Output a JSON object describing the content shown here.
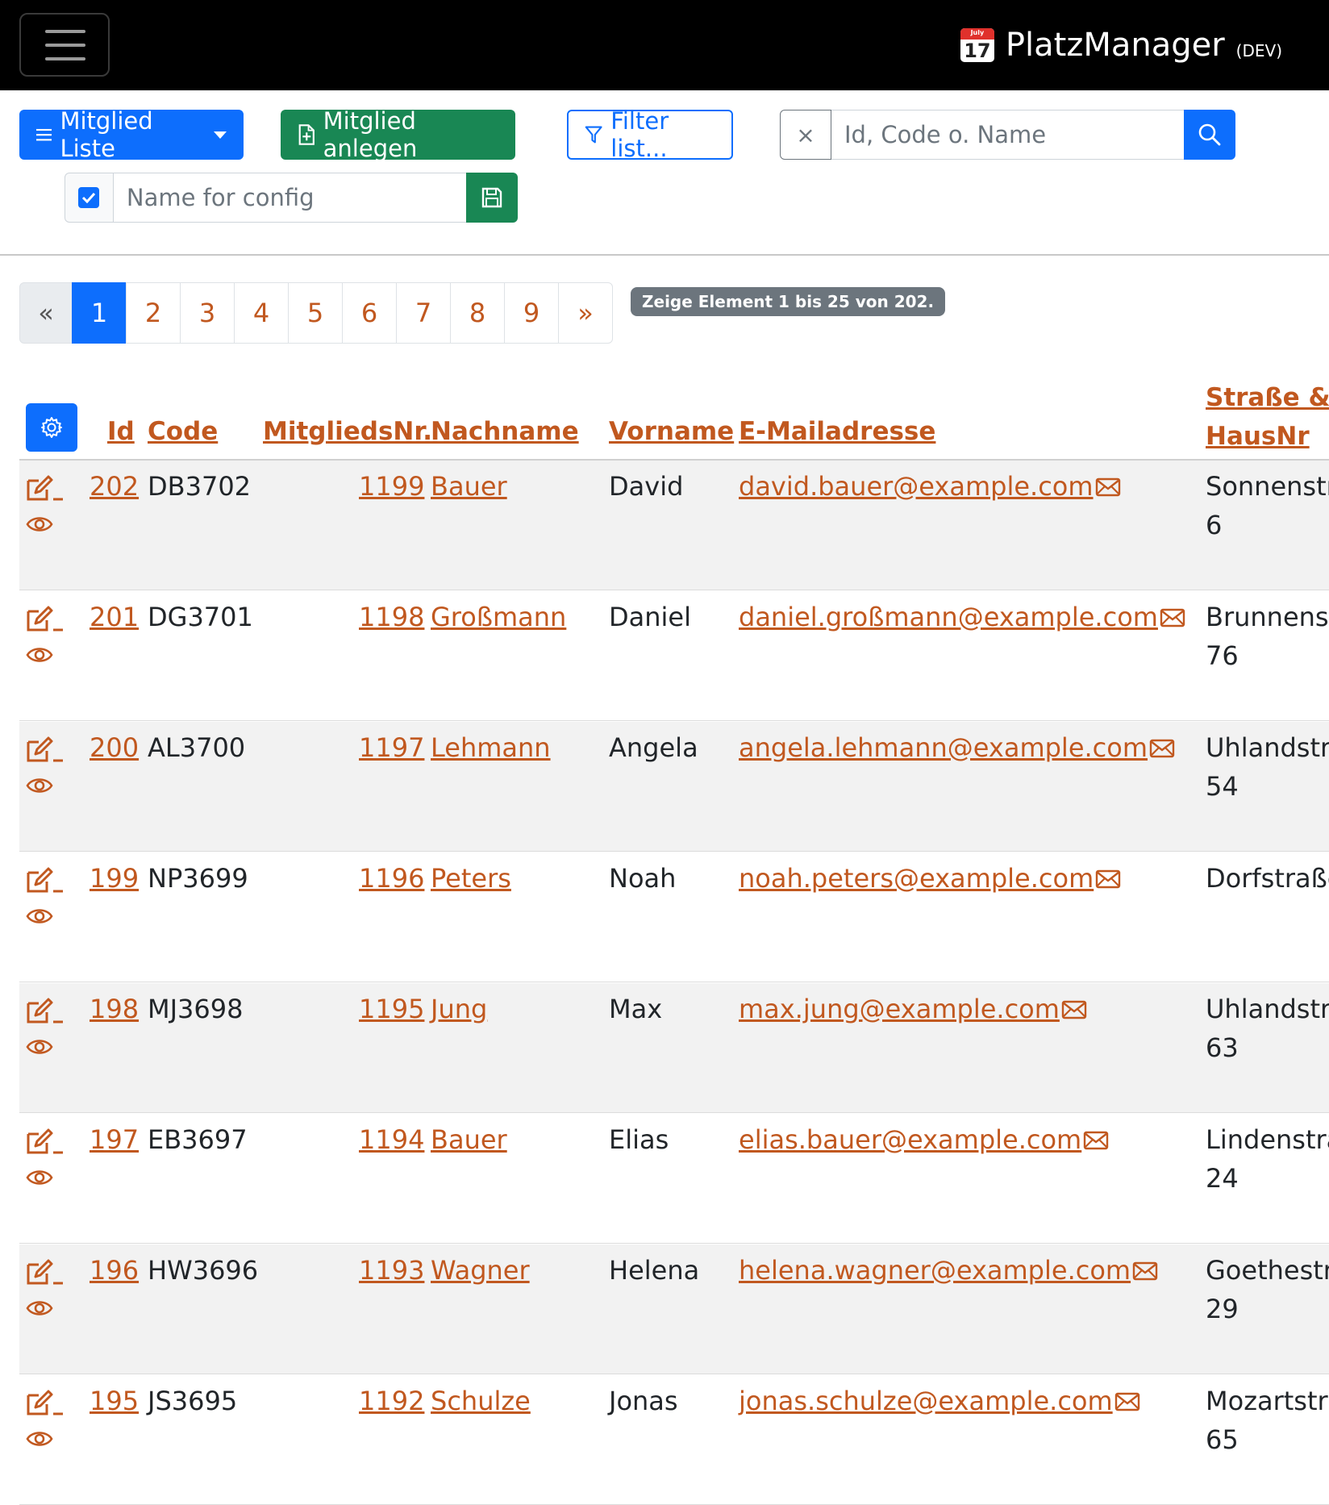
{
  "navbar": {
    "brand": "PlatzManager",
    "env": "(DEV)",
    "calendar_month": "July",
    "calendar_day": "17"
  },
  "toolbar": {
    "list_button": "Mitglied Liste",
    "create_button": "Mitglied anlegen",
    "filter_button": "Filter list...",
    "clear_symbol": "×",
    "search_placeholder": "Id, Code o. Name",
    "search_value": "",
    "config_placeholder": "Name for config",
    "config_value": ""
  },
  "pagination": {
    "prev": "«",
    "pages": [
      "1",
      "2",
      "3",
      "4",
      "5",
      "6",
      "7",
      "8",
      "9"
    ],
    "next": "»",
    "active": "1",
    "summary": "Zeige Element 1 bis 25 von 202."
  },
  "table": {
    "headers": {
      "id": "Id",
      "code": "Code",
      "mitgliedsnr": "MitgliedsNr.",
      "nachname": "Nachname",
      "vorname": "Vorname",
      "email": "E-Mailadresse",
      "strasse_line1": "Straße &",
      "strasse_line2": "HausNr"
    },
    "rows": [
      {
        "id": "202",
        "code": "DB3702",
        "nr": "1199",
        "nachname": "Bauer",
        "vorname": "David",
        "email": "david.bauer@example.com",
        "strasse": "Sonnenstr",
        "hausnr": "6"
      },
      {
        "id": "201",
        "code": "DG3701",
        "nr": "1198",
        "nachname": "Großmann",
        "vorname": "Daniel",
        "email": "daniel.großmann@example.com",
        "strasse": "Brunnenst",
        "hausnr": "76"
      },
      {
        "id": "200",
        "code": "AL3700",
        "nr": "1197",
        "nachname": "Lehmann",
        "vorname": "Angela",
        "email": "angela.lehmann@example.com",
        "strasse": "Uhlandstra",
        "hausnr": "54"
      },
      {
        "id": "199",
        "code": "NP3699",
        "nr": "1196",
        "nachname": "Peters",
        "vorname": "Noah",
        "email": "noah.peters@example.com",
        "strasse": "Dorfstraße",
        "hausnr": ""
      },
      {
        "id": "198",
        "code": "MJ3698",
        "nr": "1195",
        "nachname": "Jung",
        "vorname": "Max",
        "email": "max.jung@example.com",
        "strasse": "Uhlandstra",
        "hausnr": "63"
      },
      {
        "id": "197",
        "code": "EB3697",
        "nr": "1194",
        "nachname": "Bauer",
        "vorname": "Elias",
        "email": "elias.bauer@example.com",
        "strasse": "Lindenstra",
        "hausnr": "24"
      },
      {
        "id": "196",
        "code": "HW3696",
        "nr": "1193",
        "nachname": "Wagner",
        "vorname": "Helena",
        "email": "helena.wagner@example.com",
        "strasse": "Goethestra",
        "hausnr": "29"
      },
      {
        "id": "195",
        "code": "JS3695",
        "nr": "1192",
        "nachname": "Schulze",
        "vorname": "Jonas",
        "email": "jonas.schulze@example.com",
        "strasse": "Mozartstra",
        "hausnr": "65"
      }
    ]
  },
  "colors": {
    "primary": "#0d6efd",
    "success": "#198754",
    "link": "#c1581f",
    "badge": "#6c757d"
  }
}
